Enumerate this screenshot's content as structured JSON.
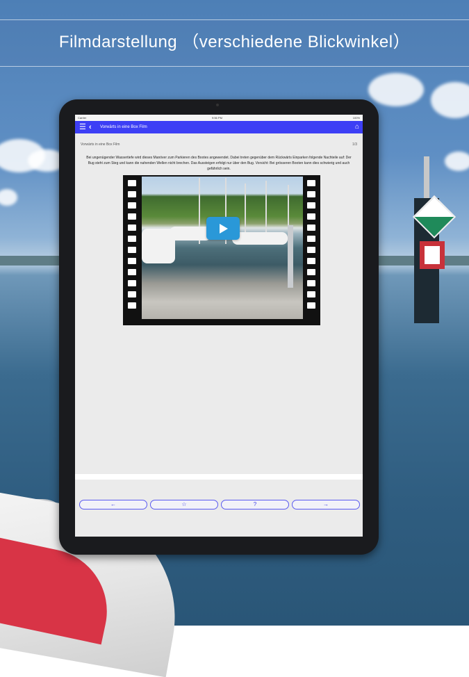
{
  "header": {
    "title": "Filmdarstellung （verschiedene  Blickwinkel）"
  },
  "statusbar": {
    "carrier": "Carrier",
    "time": "9:56 PM",
    "battery": "100%"
  },
  "navbar": {
    "title": "Vorwärts in eine Box Film",
    "accent": "#3d3ff5"
  },
  "content": {
    "breadcrumb": "Vorwärts in eine Box Film",
    "page_indicator": "1/3",
    "paragraph": "Bei ungenügender Wassertiefe wird dieses Manöver zum Parkieren des Bootes angewendet. Dabei treten gegenüber dem Rückwärts Einparken folgende Nachteile auf: Der Bug steht zum Steg und kann die nahenden Wellen nicht brechen. Das Aussteigen erfolgt nur über den Bug. Vorsicht: Bei grösseren Booten kann dies schwierig und auch gefährlich sein.",
    "video": {
      "play_icon": "play-icon",
      "play_color": "#2a98d8"
    }
  },
  "toolbar": {
    "back_label": "←",
    "favorite_label": "☆",
    "help_label": "?",
    "forward_label": "→"
  }
}
